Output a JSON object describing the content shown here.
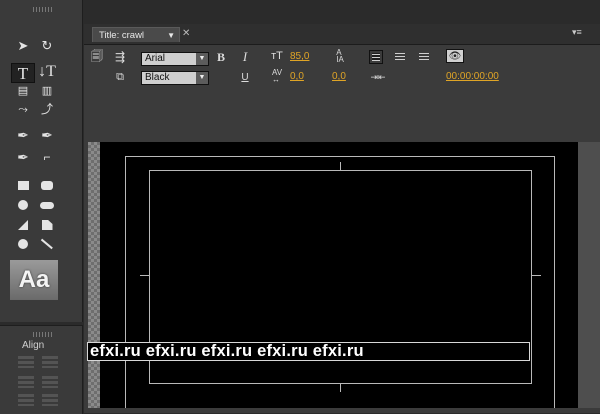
{
  "title_tab": {
    "label": "Title: crawl",
    "dropdown_glyph": "▼",
    "close_glyph": "✕",
    "panel_menu_glyph": "▾≡"
  },
  "toolbar": {
    "font_family": "Arial",
    "font_style": "Black",
    "bold_label": "B",
    "italic_label": "I",
    "underline_label": "U",
    "font_size": "85,0",
    "kerning": "0,0",
    "leading": "0,0",
    "timecode": "00:00:00:00"
  },
  "canvas": {
    "crawl_text": "efxi.ru efxi.ru efxi.ru efxi.ru efxi.ru"
  },
  "style_swatch": {
    "label": "Aa"
  },
  "align_panel": {
    "title": "Align"
  },
  "colors": {
    "accent_value": "#e0a526",
    "panel_bg": "#3b3b3b",
    "canvas_bg": "#000000"
  }
}
